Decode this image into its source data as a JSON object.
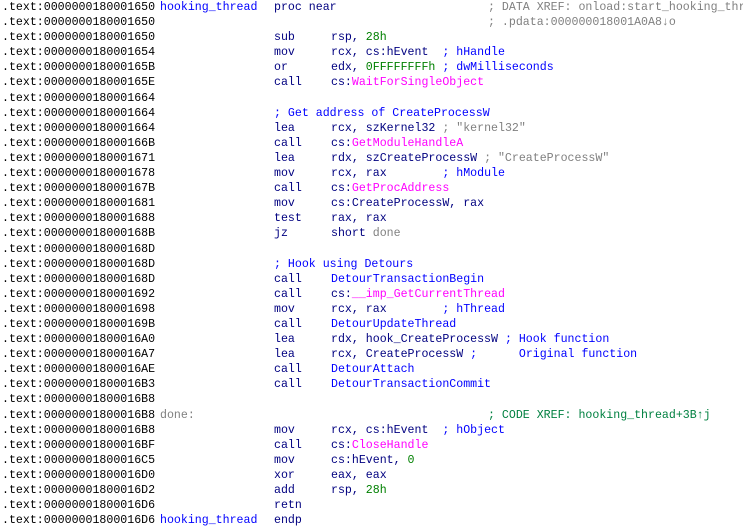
{
  "lines": [
    {
      "addr": ".text:0000000180001650",
      "label": "hooking_thread",
      "label_color": "name",
      "mnem": "proc near",
      "ops": [],
      "comment": "; DATA XREF: onload:start_hooking_thread↓o",
      "comment_color": "gray",
      "comment_pos": "far"
    },
    {
      "addr": ".text:0000000180001650",
      "comment": "; .pdata:000000018001A0A8↓o",
      "comment_color": "gray",
      "comment_pos": "far"
    },
    {
      "addr": ".text:0000000180001650",
      "mnem": "sub",
      "ops": [
        {
          "t": "rsp, ",
          "c": "reg"
        },
        {
          "t": "28h",
          "c": "num"
        }
      ]
    },
    {
      "addr": ".text:0000000180001654",
      "mnem": "mov",
      "ops": [
        {
          "t": "rcx, cs:hEvent  ",
          "c": "reg"
        },
        {
          "t": "; hHandle",
          "c": "cmt"
        }
      ]
    },
    {
      "addr": ".text:000000018000165B",
      "mnem": "or",
      "ops": [
        {
          "t": "edx, ",
          "c": "reg"
        },
        {
          "t": "0FFFFFFFFh",
          "c": "num"
        },
        {
          "t": " ; dwMilliseconds",
          "c": "cmt"
        }
      ]
    },
    {
      "addr": ".text:000000018000165E",
      "mnem": "call",
      "ops": [
        {
          "t": "cs:",
          "c": "reg"
        },
        {
          "t": "WaitForSingleObject",
          "c": "import"
        }
      ]
    },
    {
      "addr": ".text:0000000180001664"
    },
    {
      "addr": ".text:0000000180001664",
      "block_comment": "; Get address of CreateProcessW"
    },
    {
      "addr": ".text:0000000180001664",
      "mnem": "lea",
      "ops": [
        {
          "t": "rcx, szKernel32 ",
          "c": "reg"
        },
        {
          "t": "; \"kernel32\"",
          "c": "str"
        }
      ]
    },
    {
      "addr": ".text:000000018000166B",
      "mnem": "call",
      "ops": [
        {
          "t": "cs:",
          "c": "reg"
        },
        {
          "t": "GetModuleHandleA",
          "c": "import"
        }
      ]
    },
    {
      "addr": ".text:0000000180001671",
      "mnem": "lea",
      "ops": [
        {
          "t": "rdx, szCreateProcessW ",
          "c": "reg"
        },
        {
          "t": "; \"CreateProcessW\"",
          "c": "str"
        }
      ]
    },
    {
      "addr": ".text:0000000180001678",
      "mnem": "mov",
      "ops": [
        {
          "t": "rcx, rax        ",
          "c": "reg"
        },
        {
          "t": "; hModule",
          "c": "cmt"
        }
      ]
    },
    {
      "addr": ".text:000000018000167B",
      "mnem": "call",
      "ops": [
        {
          "t": "cs:",
          "c": "reg"
        },
        {
          "t": "GetProcAddress",
          "c": "import"
        }
      ]
    },
    {
      "addr": ".text:0000000180001681",
      "mnem": "mov",
      "ops": [
        {
          "t": "cs:CreateProcessW, rax",
          "c": "reg"
        }
      ]
    },
    {
      "addr": ".text:0000000180001688",
      "mnem": "test",
      "ops": [
        {
          "t": "rax, rax",
          "c": "reg"
        }
      ]
    },
    {
      "addr": ".text:000000018000168B",
      "mnem": "jz",
      "ops": [
        {
          "t": "short ",
          "c": "reg"
        },
        {
          "t": "done",
          "c": "gray"
        }
      ]
    },
    {
      "addr": ".text:000000018000168D"
    },
    {
      "addr": ".text:000000018000168D",
      "block_comment": "; Hook using Detours"
    },
    {
      "addr": ".text:000000018000168D",
      "mnem": "call",
      "ops": [
        {
          "t": "DetourTransactionBegin",
          "c": "name"
        }
      ]
    },
    {
      "addr": ".text:0000000180001692",
      "mnem": "call",
      "ops": [
        {
          "t": "cs:",
          "c": "reg"
        },
        {
          "t": "__imp_GetCurrentThread",
          "c": "import"
        }
      ]
    },
    {
      "addr": ".text:0000000180001698",
      "mnem": "mov",
      "ops": [
        {
          "t": "rcx, rax        ",
          "c": "reg"
        },
        {
          "t": "; hThread",
          "c": "cmt"
        }
      ]
    },
    {
      "addr": ".text:000000018000169B",
      "mnem": "call",
      "ops": [
        {
          "t": "DetourUpdateThread",
          "c": "name"
        }
      ]
    },
    {
      "addr": ".text:00000001800016A0",
      "mnem": "lea",
      "ops": [
        {
          "t": "rdx, hook_CreateProcessW ",
          "c": "reg"
        },
        {
          "t": "; Hook function",
          "c": "cmt"
        }
      ]
    },
    {
      "addr": ".text:00000001800016A7",
      "mnem": "lea",
      "ops": [
        {
          "t": "rcx, CreateProcessW ",
          "c": "reg"
        },
        {
          "t": ";      Original function",
          "c": "cmt"
        }
      ]
    },
    {
      "addr": ".text:00000001800016AE",
      "mnem": "call",
      "ops": [
        {
          "t": "DetourAttach",
          "c": "name"
        }
      ]
    },
    {
      "addr": ".text:00000001800016B3",
      "mnem": "call",
      "ops": [
        {
          "t": "DetourTransactionCommit",
          "c": "name"
        }
      ]
    },
    {
      "addr": ".text:00000001800016B8"
    },
    {
      "addr": ".text:00000001800016B8",
      "label": "done:",
      "label_color": "gray",
      "comment": "; CODE XREF: hooking_thread+3B↑j",
      "comment_color": "xref",
      "comment_pos": "far"
    },
    {
      "addr": ".text:00000001800016B8",
      "mnem": "mov",
      "ops": [
        {
          "t": "rcx, cs:hEvent  ",
          "c": "reg"
        },
        {
          "t": "; hObject",
          "c": "cmt"
        }
      ]
    },
    {
      "addr": ".text:00000001800016BF",
      "mnem": "call",
      "ops": [
        {
          "t": "cs:",
          "c": "reg"
        },
        {
          "t": "CloseHandle",
          "c": "import"
        }
      ]
    },
    {
      "addr": ".text:00000001800016C5",
      "mnem": "mov",
      "ops": [
        {
          "t": "cs:hEvent, ",
          "c": "reg"
        },
        {
          "t": "0",
          "c": "num"
        }
      ]
    },
    {
      "addr": ".text:00000001800016D0",
      "mnem": "xor",
      "ops": [
        {
          "t": "eax, eax",
          "c": "reg"
        }
      ]
    },
    {
      "addr": ".text:00000001800016D2",
      "mnem": "add",
      "ops": [
        {
          "t": "rsp, ",
          "c": "reg"
        },
        {
          "t": "28h",
          "c": "num"
        }
      ]
    },
    {
      "addr": ".text:00000001800016D6",
      "mnem": "retn",
      "ops": []
    },
    {
      "addr": ".text:00000001800016D6",
      "label": "hooking_thread",
      "label_color": "name",
      "mnem": "endp",
      "ops": []
    }
  ]
}
